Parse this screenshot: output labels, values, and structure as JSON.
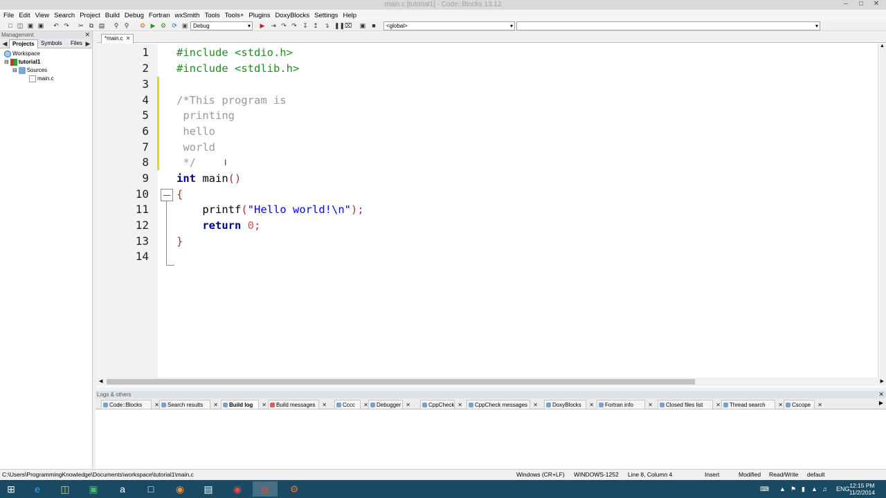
{
  "window": {
    "title": "main.c [tutorial1] - Code::Blocks 13.12"
  },
  "menu": [
    "File",
    "Edit",
    "View",
    "Search",
    "Project",
    "Build",
    "Debug",
    "Fortran",
    "wxSmith",
    "Tools",
    "Tools+",
    "Plugins",
    "DoxyBlocks",
    "Settings",
    "Help"
  ],
  "toolbar": {
    "build_target": "Debug",
    "scope": "<global>",
    "function": ""
  },
  "management": {
    "header": "Management",
    "tabs": [
      "Projects",
      "Symbols",
      "Files"
    ],
    "tree": {
      "workspace": "Workspace",
      "project": "tutorial1",
      "folder": "Sources",
      "file": "main.c"
    }
  },
  "editor": {
    "tab": "*main.c",
    "line_numbers": [
      "1",
      "2",
      "3",
      "4",
      "5",
      "6",
      "7",
      "8",
      "9",
      "10",
      "11",
      "12",
      "13",
      "14"
    ],
    "lines": {
      "l1": "#include <stdio.h>",
      "l2": "#include <stdlib.h>",
      "l4": "/*This program is",
      "l5": " printing",
      "l6": " hello",
      "l7": " world",
      "l8": " */",
      "l9_kw": "int",
      "l9_fn": " main",
      "l9_br": "()",
      "l10": "{",
      "l11_fn": "    printf",
      "l11_open": "(",
      "l11_str": "\"Hello world!\\n\"",
      "l11_close": ");",
      "l12_kw": "    return",
      "l12_num": " 0",
      "l12_semi": ";",
      "l13": "}"
    }
  },
  "logs": {
    "header": "Logs & others",
    "tabs": [
      "Code::Blocks",
      "Search results",
      "Build log",
      "Build messages",
      "Cccc",
      "Debugger",
      "CppCheck",
      "CppCheck messages",
      "DoxyBlocks",
      "Fortran info",
      "Closed files list",
      "Thread search",
      "Cscope"
    ],
    "active_tab": "Build log"
  },
  "status": {
    "path": "C:\\Users\\ProgrammingKnowledge\\Documents\\workspace\\tutorial1\\main.c",
    "eol": "Windows (CR+LF)",
    "encoding": "WINDOWS-1252",
    "position": "Line 8, Column 4",
    "mode": "Insert",
    "modified": "Modified",
    "access": "Read/Write",
    "profile": "default"
  },
  "taskbar": {
    "lang": "ENG",
    "time": "12:15 PM",
    "date": "11/2/2014"
  }
}
